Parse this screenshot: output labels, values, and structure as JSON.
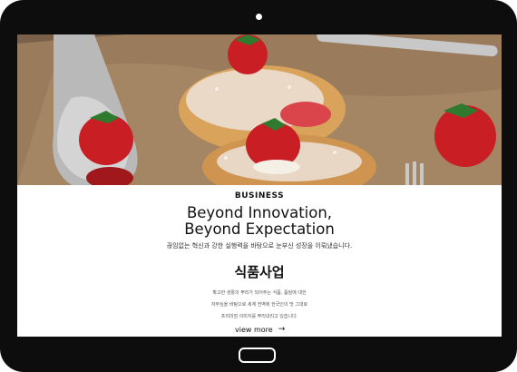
{
  "hero": {
    "icon": "dessert-photo"
  },
  "section": {
    "eyebrow": "BUSINESS",
    "title_line1": "Beyond Innovation,",
    "title_line2": "Beyond Expectation",
    "subtitle": "끊임없는 혁신과 강한 실행력을 바탕으로 눈부신 성장을 이뤄냈습니다.",
    "heading": "식품사업",
    "description": [
      "확고한 생활의 뿌리가 되어주는 식품, 품질에 대한",
      "자부심을 바탕으로 세계 전역에 한국인의 맛 그대로",
      "프리미엄 이미지를 뿌리내리고 있습니다."
    ],
    "link_label": "view more",
    "link_icon": "arrow-right-icon"
  },
  "colors": {
    "frame": "#0d0d0d",
    "text": "#111111",
    "accent_berry": "#c81e24"
  }
}
